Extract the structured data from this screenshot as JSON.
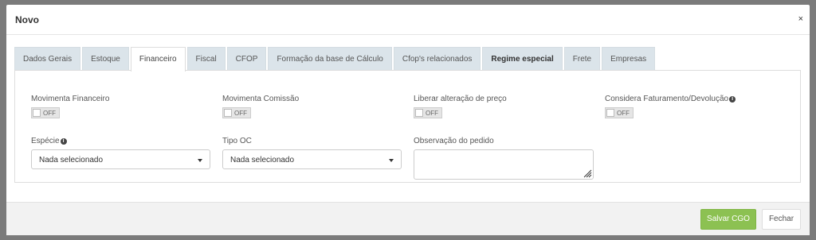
{
  "modal": {
    "title": "Novo",
    "close_label": "×"
  },
  "tabs": [
    {
      "label": "Dados Gerais"
    },
    {
      "label": "Estoque"
    },
    {
      "label": "Financeiro"
    },
    {
      "label": "Fiscal"
    },
    {
      "label": "CFOP"
    },
    {
      "label": "Formação da base de Cálculo"
    },
    {
      "label": "Cfop's relacionados"
    },
    {
      "label": "Regime especial"
    },
    {
      "label": "Frete"
    },
    {
      "label": "Empresas"
    }
  ],
  "active_tab": "Financeiro",
  "fields": {
    "movimenta_financeiro": {
      "label": "Movimenta Financeiro",
      "toggle": "OFF"
    },
    "movimenta_comissao": {
      "label": "Movimenta Comissão",
      "toggle": "OFF"
    },
    "liberar_alteracao_preco": {
      "label": "Liberar alteração de preço",
      "toggle": "OFF"
    },
    "considera_faturamento": {
      "label": "Considera Faturamento/Devolução",
      "toggle": "OFF"
    },
    "especie": {
      "label": "Espécie",
      "value": "Nada selecionado"
    },
    "tipo_oc": {
      "label": "Tipo OC",
      "value": "Nada selecionado"
    },
    "observacao_pedido": {
      "label": "Observação do pedido",
      "value": ""
    }
  },
  "footer": {
    "save_label": "Salvar CGO",
    "close_label": "Fechar"
  },
  "colors": {
    "save_button": "#8cc152",
    "tab_inactive": "#dbe4ea",
    "backdrop": "#7b7b7b"
  },
  "icons": {
    "info": "info-circle-icon"
  }
}
